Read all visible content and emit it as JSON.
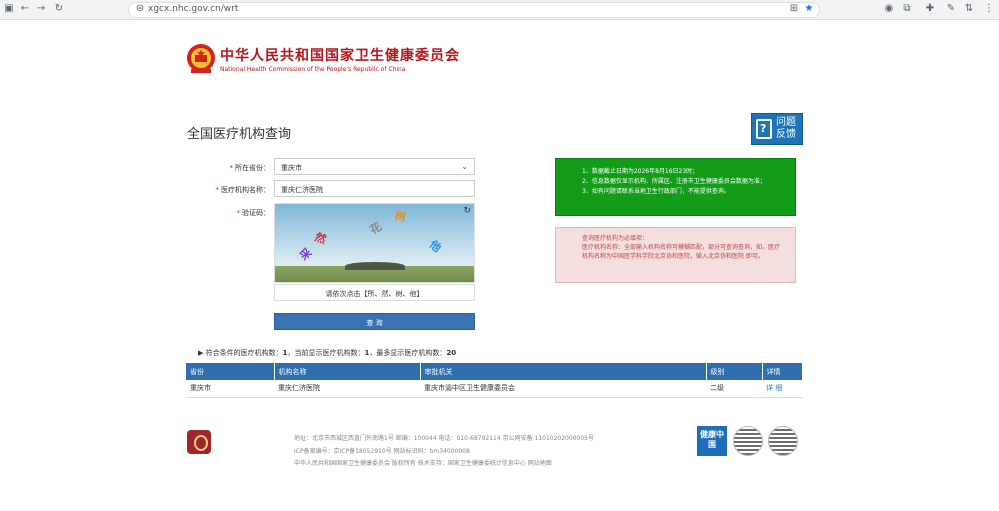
{
  "browser": {
    "url": "xgcx.nhc.gov.cn/wrt"
  },
  "header": {
    "title": "中华人民共和国国家卫生健康委员会",
    "subtitle": "National Health Commission of the People's Republic of China"
  },
  "page": {
    "title": "全国医疗机构查询",
    "feedback_label": "问题反馈"
  },
  "form": {
    "region_label": "所在省份：",
    "region_value": "重庆市",
    "name_label": "医疗机构名称：",
    "name_value": "重庆仁济医院",
    "captcha_label": "验证码：",
    "captcha_chars": [
      "采",
      "然",
      "花",
      "他",
      "树"
    ],
    "captcha_hint": "请依次点击【所、然、树、他】",
    "submit_label": "查 询"
  },
  "notice": {
    "green_lines": [
      "1、数据截止日期为2026年8月16日23时；",
      "2、信息数据仅显示机构、所属区、注册市卫生健康委员会数据为准；",
      "3、如有问题请联系当地卫生行政部门，不能提供查询。"
    ],
    "pink_lines": [
      "查询医疗机构为必填项：",
      "医疗机构名称：全部输入机构名称可模糊匹配，部分可查询查询，如，医疗机构名称为中国医学科学院北京协和医院，输入北京协和医院 即可。"
    ]
  },
  "stats": {
    "prefix": "符合条件的医疗机构数：",
    "total": "1",
    "current_prefix": "，当前显示医疗机构数：",
    "current": "1",
    "max_prefix": "，最多显示医疗机构数：",
    "max": "20"
  },
  "table": {
    "headers": [
      "省份",
      "机构名称",
      "审批机关",
      "级别",
      "详情"
    ],
    "rows": [
      [
        "重庆市",
        "重庆仁济医院",
        "重庆市渝中区卫生健康委员会",
        "二级",
        "详 细"
      ]
    ]
  },
  "footer": {
    "address": "地址：北京市西城区西直门外南路1号    邮编：100044    电话：010-68792114    京公网安备 11010202000005号",
    "icp": "ICP备案编号：京ICP备18052910号    网站标识码：bm34000008",
    "links": "中华人民共和国国家卫生健康委员会    版权所有    技术支持：国家卫生健康委统计信息中心    网站地图",
    "health_badge": "健康中国"
  },
  "colors": {
    "brand_red": "#b5161c",
    "primary_blue": "#2f6fb0",
    "notice_green": "#129c18",
    "notice_pink": "#f4dede"
  }
}
